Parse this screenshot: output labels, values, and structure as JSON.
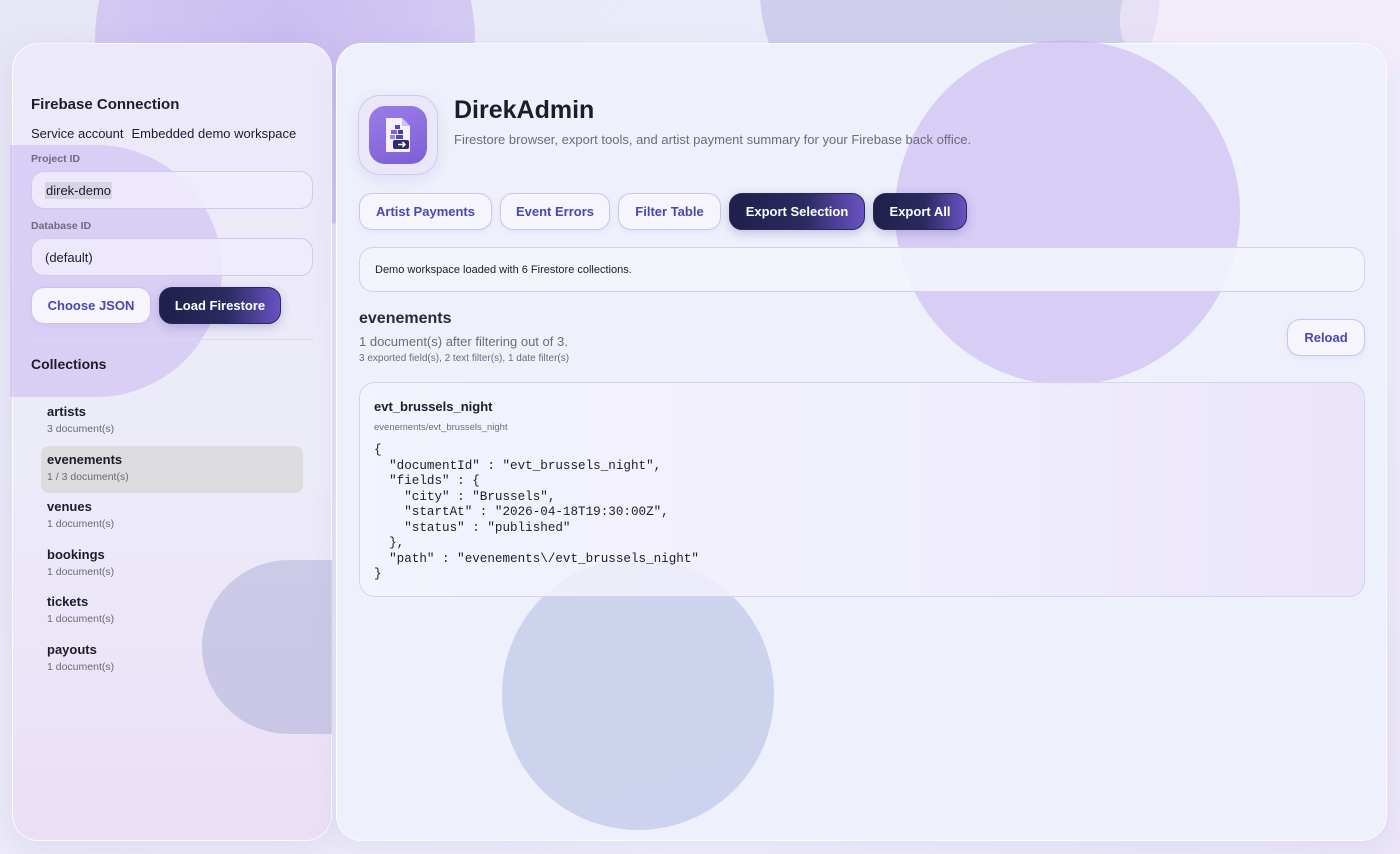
{
  "sidebar": {
    "connection_title": "Firebase Connection",
    "service_account_label": "Service account",
    "service_account_value": "Embedded demo workspace",
    "project_id_label": "Project ID",
    "project_id_value": "direk-demo",
    "database_id_label": "Database ID",
    "database_id_value": "(default)",
    "choose_json_label": "Choose JSON",
    "load_firestore_label": "Load Firestore",
    "collections_title": "Collections",
    "collections": [
      {
        "name": "artists",
        "count": "3 document(s)"
      },
      {
        "name": "evenements",
        "count": "1 / 3 document(s)",
        "active": true
      },
      {
        "name": "venues",
        "count": "1 document(s)"
      },
      {
        "name": "bookings",
        "count": "1 document(s)"
      },
      {
        "name": "tickets",
        "count": "1 document(s)"
      },
      {
        "name": "payouts",
        "count": "1 document(s)"
      }
    ]
  },
  "header": {
    "app_name": "DirekAdmin",
    "subtitle": "Firestore browser, export tools, and artist payment summary for your Firebase back office.",
    "logo_icon": "document-export-icon"
  },
  "toolbar": {
    "artist_payments_label": "Artist Payments",
    "event_errors_label": "Event Errors",
    "filter_table_label": "Filter Table",
    "export_selection_label": "Export Selection",
    "export_all_label": "Export All"
  },
  "status_message": "Demo workspace loaded with 6 Firestore collections.",
  "collection_view": {
    "title": "evenements",
    "summary": "1 document(s) after filtering out of 3.",
    "detail": "3 exported field(s), 2 text filter(s), 1 date filter(s)",
    "reload_label": "Reload"
  },
  "document": {
    "id": "evt_brussels_night",
    "path": "evenements/evt_brussels_night",
    "json": "{\n  \"documentId\" : \"evt_brussels_night\",\n  \"fields\" : {\n    \"city\" : \"Brussels\",\n    \"startAt\" : \"2026-04-18T19:30:00Z\",\n    \"status\" : \"published\"\n  },\n  \"path\" : \"evenements\\/evt_brussels_night\"\n}"
  },
  "colors": {
    "accent_dark": "#1f1f4a",
    "accent_purple": "#7d5fd6",
    "button_text_light": "#4a49a8"
  }
}
